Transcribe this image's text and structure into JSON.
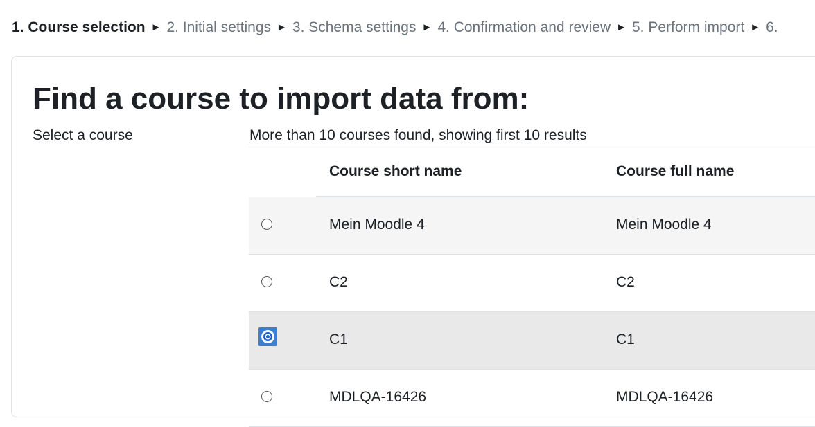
{
  "progress": {
    "steps": [
      "1. Course selection",
      "2. Initial settings",
      "3. Schema settings",
      "4. Confirmation and review",
      "5. Perform import",
      "6."
    ],
    "separator": "►"
  },
  "page": {
    "title": "Find a course to import data from:",
    "select_label": "Select a course",
    "results_note": "More than 10 courses found, showing first 10 results"
  },
  "table": {
    "headers": [
      "Course short name",
      "Course full name"
    ],
    "rows": [
      {
        "short": "Mein Moodle 4",
        "full": "Mein Moodle 4",
        "checked": false
      },
      {
        "short": "C2",
        "full": "C2",
        "checked": false
      },
      {
        "short": "C1",
        "full": "C1",
        "checked": true
      },
      {
        "short": "MDLQA-16426",
        "full": "MDLQA-16426",
        "checked": false
      }
    ]
  }
}
